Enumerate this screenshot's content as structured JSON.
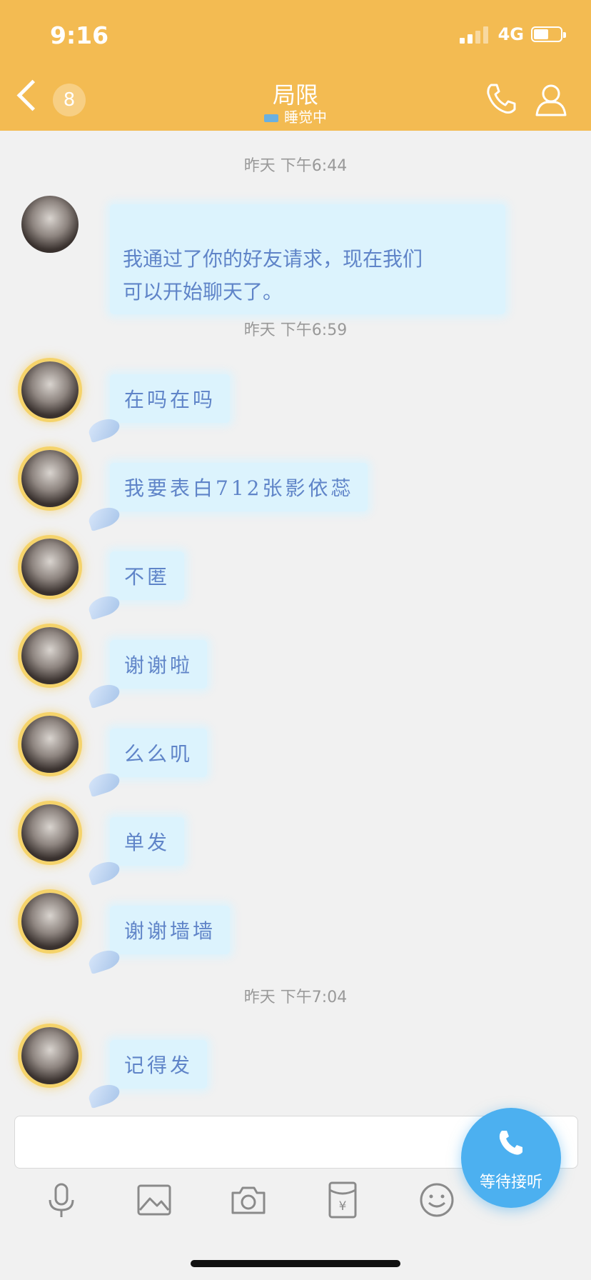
{
  "status": {
    "time": "9:16",
    "network": "4G"
  },
  "header": {
    "unread_count": "8",
    "title": "局限",
    "subtitle": "睡觉中"
  },
  "conversation": [
    {
      "type": "timestamp",
      "text": "昨天 下午6:44"
    },
    {
      "type": "message",
      "text": "我通过了你的好友请求，现在我们\n可以开始聊天了。",
      "style": "plain"
    },
    {
      "type": "timestamp",
      "text": "昨天 下午6:59"
    },
    {
      "type": "message",
      "text": "在吗在吗",
      "style": "fancy"
    },
    {
      "type": "message",
      "text": "我要表白712张影依蕊",
      "style": "fancy"
    },
    {
      "type": "message",
      "text": "不匿",
      "style": "fancy"
    },
    {
      "type": "message",
      "text": "谢谢啦",
      "style": "fancy"
    },
    {
      "type": "message",
      "text": "么么叽",
      "style": "fancy"
    },
    {
      "type": "message",
      "text": "单发",
      "style": "fancy"
    },
    {
      "type": "message",
      "text": "谢谢墙墙",
      "style": "fancy"
    },
    {
      "type": "timestamp",
      "text": "昨天 下午7:04"
    },
    {
      "type": "message",
      "text": "记得发",
      "style": "fancy"
    }
  ],
  "input": {
    "value": "",
    "placeholder": ""
  },
  "toolbar": {
    "icons": [
      "microphone-icon",
      "image-icon",
      "camera-icon",
      "red-packet-icon",
      "emoji-icon"
    ]
  },
  "call_button": {
    "label": "等待接听"
  },
  "colors": {
    "header": "#f3bb52",
    "bubble": "#dcf3fd",
    "bubble_text": "#5f84c8",
    "call_button": "#4cb0f0"
  }
}
